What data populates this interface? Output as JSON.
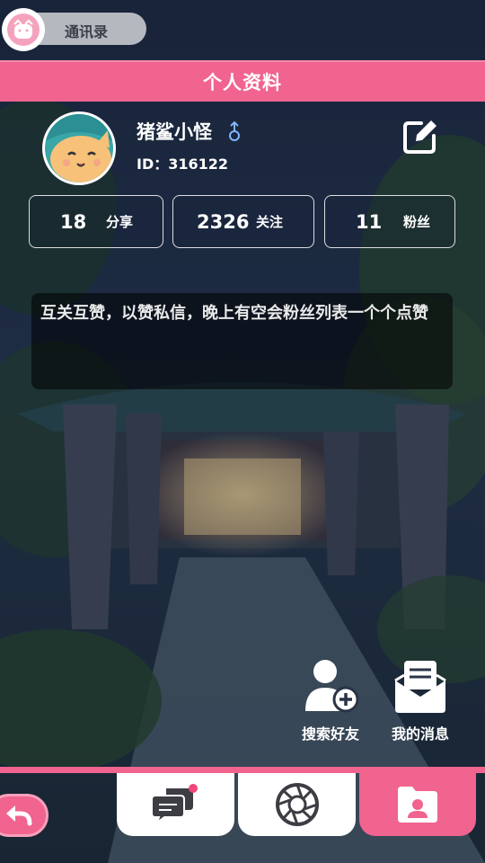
{
  "top": {
    "contacts_label": "通讯录"
  },
  "header": {
    "title": "个人资料"
  },
  "profile": {
    "name": "猪鲨小怪",
    "gender_symbol": "♂",
    "id_text": "ID：316122"
  },
  "stats": [
    {
      "value": "18",
      "label": "分享"
    },
    {
      "value": "2326",
      "label": "关注"
    },
    {
      "value": "11",
      "label": "粉丝"
    }
  ],
  "bio": "互关互赞，以赞私信，晚上有空会粉丝列表一个个点赞",
  "actions": {
    "search_friends": "搜索好友",
    "my_messages": "我的消息"
  },
  "icons": {
    "contacts": "contacts-avatar-icon",
    "edit": "edit-icon",
    "search_friends": "add-user-icon",
    "messages": "envelope-icon",
    "nav_chat": "chat-bubbles-icon",
    "nav_camera": "camera-aperture-icon",
    "nav_profile": "profile-folder-icon",
    "back": "back-arrow-icon"
  },
  "colors": {
    "accent": "#f0648f",
    "gender": "#7fb6ff",
    "notification_dot": "#f0467a"
  }
}
